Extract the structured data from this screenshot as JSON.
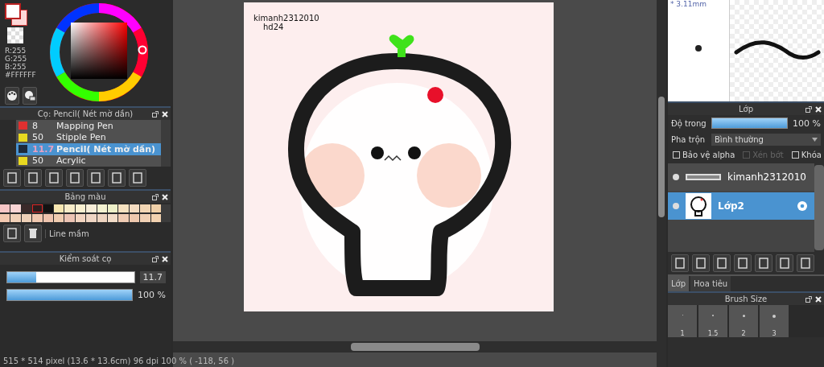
{
  "color_panel": {
    "r": "R:255",
    "g": "G:255",
    "b": "B:255",
    "hex": "#FFFFFF"
  },
  "brush_panel": {
    "title": "Cọ: Pencil( Nét mờ dần)",
    "brushes": [
      {
        "color": "#e03030",
        "size": "8",
        "name": "Mapping Pen",
        "selected": false
      },
      {
        "color": "#e8d820",
        "size": "50",
        "name": "Stipple Pen",
        "selected": false
      },
      {
        "color": "#1e2a3a",
        "size": "11.7",
        "name": "Pencil( Nét mờ dần)",
        "selected": true
      },
      {
        "color": "#e8d820",
        "size": "50",
        "name": "Acrylic",
        "selected": false
      }
    ]
  },
  "palette_panel": {
    "title": "Bảng màu",
    "palette_name": "Line mầm",
    "swatches": [
      {
        "color": "#f6c6c6",
        "selected": false
      },
      {
        "color": "#f8d4d4",
        "selected": false
      },
      {
        "color": "#3a2a2a",
        "selected": false
      },
      {
        "color": "#2a1e1e",
        "selected": true
      },
      {
        "color": "#121212",
        "selected": false
      },
      {
        "color": "#f6e6b0",
        "selected": false
      },
      {
        "color": "#f8ecc8",
        "selected": false
      },
      {
        "color": "#faf0d0",
        "selected": false
      },
      {
        "color": "#f8eed8",
        "selected": false
      },
      {
        "color": "#f4f2d0",
        "selected": false
      },
      {
        "color": "#eef0c8",
        "selected": false
      },
      {
        "color": "#f6e2c0",
        "selected": false
      },
      {
        "color": "#f4dcc0",
        "selected": false
      },
      {
        "color": "#f2d6b4",
        "selected": false
      },
      {
        "color": "#f0d0a8",
        "selected": false
      },
      {
        "color": "#f2c8b0",
        "selected": false
      },
      {
        "color": "#f0d0b8",
        "selected": false
      },
      {
        "color": "#eed0b8",
        "selected": false
      },
      {
        "color": "#f0c8b0",
        "selected": false
      },
      {
        "color": "#eec4ae",
        "selected": false
      },
      {
        "color": "#f0ccb0",
        "selected": false
      },
      {
        "color": "#ecc4b4",
        "selected": false
      },
      {
        "color": "#f2d4c0",
        "selected": false
      },
      {
        "color": "#f0d6c4",
        "selected": false
      },
      {
        "color": "#eed4c0",
        "selected": false
      },
      {
        "color": "#f2dcc8",
        "selected": false
      },
      {
        "color": "#f0ccb4",
        "selected": false
      },
      {
        "color": "#eec8ae",
        "selected": false
      },
      {
        "color": "#f0d0b4",
        "selected": false
      },
      {
        "color": "#f2d2b0",
        "selected": false
      }
    ]
  },
  "brush_control": {
    "title": "Kiểm soát cọ",
    "size": {
      "level": 0.23,
      "reading": "11.7"
    },
    "opacity": {
      "level": 1.0,
      "reading": "100 %"
    }
  },
  "canvas": {
    "texts": [
      "kimanh2312010",
      "hd24"
    ]
  },
  "status_bar": "515 * 514 pixel   (13.6 * 13.6cm)   96 dpi   100 %   ( -118, 56 )",
  "brush_preview": {
    "size": "* 3.11mm"
  },
  "layer_panel": {
    "title": "Lớp",
    "opacity_label": "Độ trong",
    "opacity": {
      "level": 1.0,
      "reading": "100 %"
    },
    "blend_label": "Pha trộn",
    "blend": "Bình thường",
    "options": [
      {
        "label": "Bảo vệ alpha",
        "checked": false,
        "disabled": false
      },
      {
        "label": "Xén bớt",
        "checked": false,
        "disabled": true
      },
      {
        "label": "Khóa",
        "checked": false,
        "disabled": false
      }
    ],
    "layers": [
      {
        "name": "kimanh2312010",
        "kind": "text",
        "visible": true,
        "selected": false
      },
      {
        "name": "Lớp2",
        "kind": "image",
        "visible": true,
        "selected": true
      }
    ]
  },
  "bottom_tabs": [
    {
      "label": "Lớp",
      "selected": true
    },
    {
      "label": "Hoa tiêu",
      "selected": false
    }
  ],
  "brush_size": {
    "title": "Brush Size",
    "sizes": [
      "1",
      "1.5",
      "2",
      "3"
    ]
  }
}
